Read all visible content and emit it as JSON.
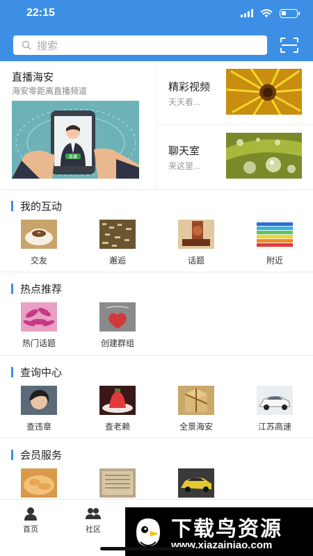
{
  "status_bar": {
    "time": "22:15"
  },
  "search": {
    "placeholder": "搜索"
  },
  "live": {
    "title": "直播海安",
    "subtitle": "海安零距离直播频道",
    "button_text": "直播"
  },
  "featured": [
    {
      "title": "精彩视频",
      "subtitle": "天天看..."
    },
    {
      "title": "聊天室",
      "subtitle": "来这里..."
    }
  ],
  "sections": [
    {
      "title": "我的互动",
      "items": [
        {
          "label": "交友"
        },
        {
          "label": "邂逅"
        },
        {
          "label": "话题"
        },
        {
          "label": "附近"
        }
      ]
    },
    {
      "title": "热点推荐",
      "items": [
        {
          "label": "热门话题"
        },
        {
          "label": "创建群组"
        }
      ]
    },
    {
      "title": "查询中心",
      "items": [
        {
          "label": "查违章"
        },
        {
          "label": "查老赖"
        },
        {
          "label": "全景海安"
        },
        {
          "label": "江苏高速"
        }
      ]
    },
    {
      "title": "会员服务",
      "items": [
        {
          "label": ""
        },
        {
          "label": ""
        },
        {
          "label": ""
        }
      ]
    }
  ],
  "bottom_nav": [
    {
      "label": "首页",
      "icon": "person-icon"
    },
    {
      "label": "社区",
      "icon": "group-icon"
    }
  ],
  "watermark": {
    "title": "下载鸟资源",
    "url": "www.xiazainiao.com"
  },
  "colors": {
    "accent": "#3d8fe6"
  }
}
